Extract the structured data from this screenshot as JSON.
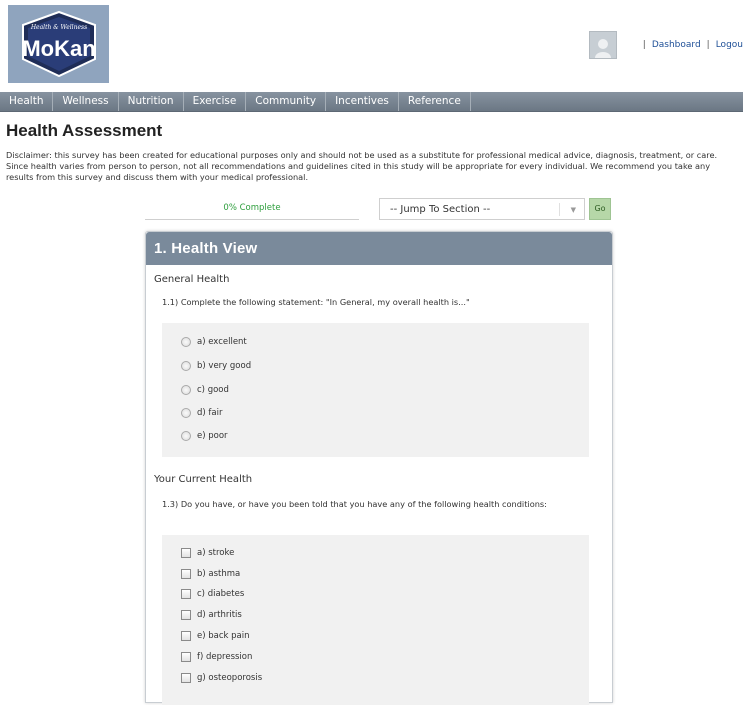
{
  "header": {
    "logo": {
      "tagline": "Health & Wellness",
      "brand": "MoKan"
    },
    "links": [
      "Dashboard",
      "Logou"
    ],
    "separator": "|"
  },
  "nav": {
    "items": [
      "Health",
      "Wellness",
      "Nutrition",
      "Exercise",
      "Community",
      "Incentives",
      "Reference"
    ]
  },
  "page": {
    "title": "Health Assessment",
    "disclaimer": "Disclaimer: this survey has been created for educational purposes only and should not be used as a substitute for professional medical advice, diagnosis, treatment, or care. Since health varies from person to person, not all recommendations and guidelines cited in this study will be appropriate for every individual. We recommend you take any results from this survey and discuss them with your medical professional."
  },
  "progress": {
    "label": "0% Complete"
  },
  "jump": {
    "selected": "-- Jump To Section --",
    "go": "Go"
  },
  "section": {
    "title": "1. Health View",
    "groups": [
      {
        "heading": "General Health",
        "question": "1.1) Complete the following statement: \"In General, my overall health is...\"",
        "type": "radio",
        "options": [
          "a) excellent",
          "b) very good",
          "c) good",
          "d) fair",
          "e) poor"
        ]
      },
      {
        "heading": "Your Current Health",
        "question": "1.3) Do you have, or have you been told that you have any of the following health conditions:",
        "type": "checkbox",
        "options": [
          "a) stroke",
          "b) asthma",
          "c) diabetes",
          "d) arthritis",
          "e) back pain",
          "f) depression",
          "g) osteoporosis"
        ]
      }
    ]
  },
  "colors": {
    "nav_bg": "#7a8794",
    "panel_header": "#7a8a9b",
    "progress_text": "#2d9e3c",
    "go_bg": "#b6d7a8",
    "link": "#1e4f97"
  }
}
